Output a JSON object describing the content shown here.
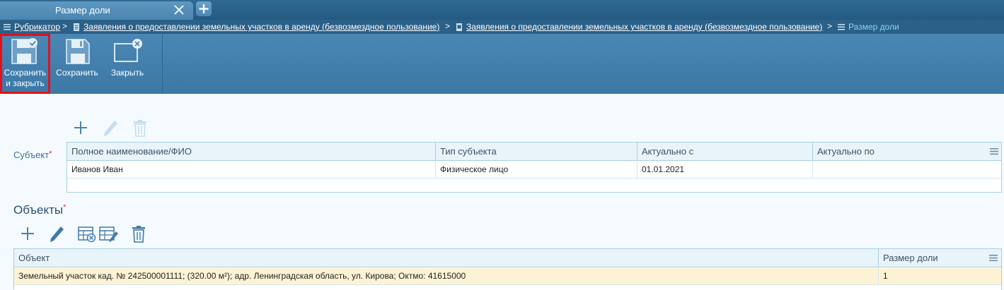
{
  "tab": {
    "title": "Размер доли"
  },
  "breadcrumb": {
    "items": [
      {
        "label": "Рубрикатор"
      },
      {
        "label": "Заявления о предоставлении земельных участков в аренду (безвозмездное пользование)"
      },
      {
        "label": "Заявления о предоставлении земельных участков в аренду (безвозмездное пользование)"
      },
      {
        "label": "Размер доли"
      }
    ],
    "separator": ">"
  },
  "toolbar": {
    "save_close_line1": "Сохранить",
    "save_close_line2": "и закрыть",
    "save_label": "Сохранить",
    "close_label": "Закрыть"
  },
  "subject": {
    "label": "Субъект",
    "required_mark": "*",
    "columns": [
      "Полное наименование/ФИО",
      "Тип субъекта",
      "Актуально с",
      "Актуально по"
    ],
    "rows": [
      {
        "name": "Иванов Иван",
        "type": "Физическое лицо",
        "from": "01.01.2021",
        "to": ""
      }
    ]
  },
  "objects": {
    "title": "Объекты",
    "required_mark": "*",
    "columns": [
      "Объект",
      "Размер доли"
    ],
    "rows": [
      {
        "object": "Земельный участок кад. № 242500001111; (320.00 м²); адр. Ленинградская область, ул. Кирова; Октмо: 41615000",
        "share": "1"
      }
    ]
  },
  "colors": {
    "tabbar": "#2f6a93",
    "toolbar": "#4b87b4",
    "accent_current_crumb": "#88d6f2",
    "highlight_outline": "#e3101e",
    "selected_row": "#fdf3d4",
    "label": "#3b6f9e"
  }
}
